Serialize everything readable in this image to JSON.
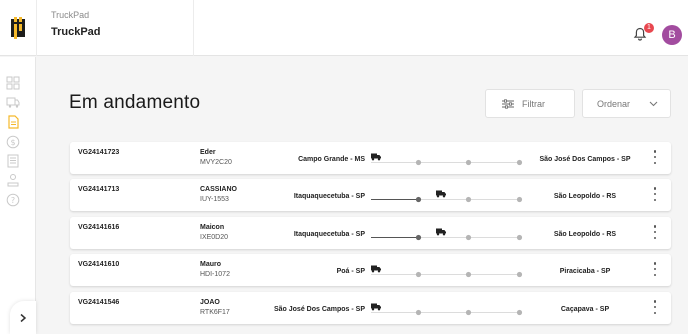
{
  "header": {
    "company_subtitle": "TruckPad",
    "company_name": "TruckPad",
    "notification_count": "1",
    "avatar_initial": "B"
  },
  "sidebar": {
    "icons": [
      "dashboard-icon",
      "truck-icon",
      "document-icon",
      "dollar-icon",
      "report-icon",
      "driver-icon",
      "help-icon"
    ],
    "active_index": 2,
    "expand_icon": "chevron-right-icon"
  },
  "page": {
    "title": "Em andamento",
    "filter_label": "Filtrar",
    "order_label": "Ordenar"
  },
  "colors": {
    "accent": "#f5b92b",
    "badge": "#e8474f",
    "avatar": "#a24c9f"
  },
  "trips": [
    {
      "code": "VG24141723",
      "driver": "Eder",
      "plate": "MVY2C20",
      "origin": "Campo Grande - MS",
      "destination": "São José Dos Campos - SP",
      "progress_stage": 0
    },
    {
      "code": "VG24141713",
      "driver": "CASSIANO",
      "plate": "IUY-1553",
      "origin": "Itaquaquecetuba - SP",
      "destination": "São Leopoldo - RS",
      "progress_stage": 1
    },
    {
      "code": "VG24141616",
      "driver": "Maicon",
      "plate": "IXE0D20",
      "origin": "Itaquaquecetuba - SP",
      "destination": "São Leopoldo - RS",
      "progress_stage": 1
    },
    {
      "code": "VG24141610",
      "driver": "Mauro",
      "plate": "HDI-1072",
      "origin": "Poá - SP",
      "destination": "Piracicaba - SP",
      "progress_stage": 0
    },
    {
      "code": "VG24141546",
      "driver": "JOAO",
      "plate": "RTK6F17",
      "origin": "São José Dos Campos - SP",
      "destination": "Caçapava - SP",
      "progress_stage": 0
    }
  ]
}
